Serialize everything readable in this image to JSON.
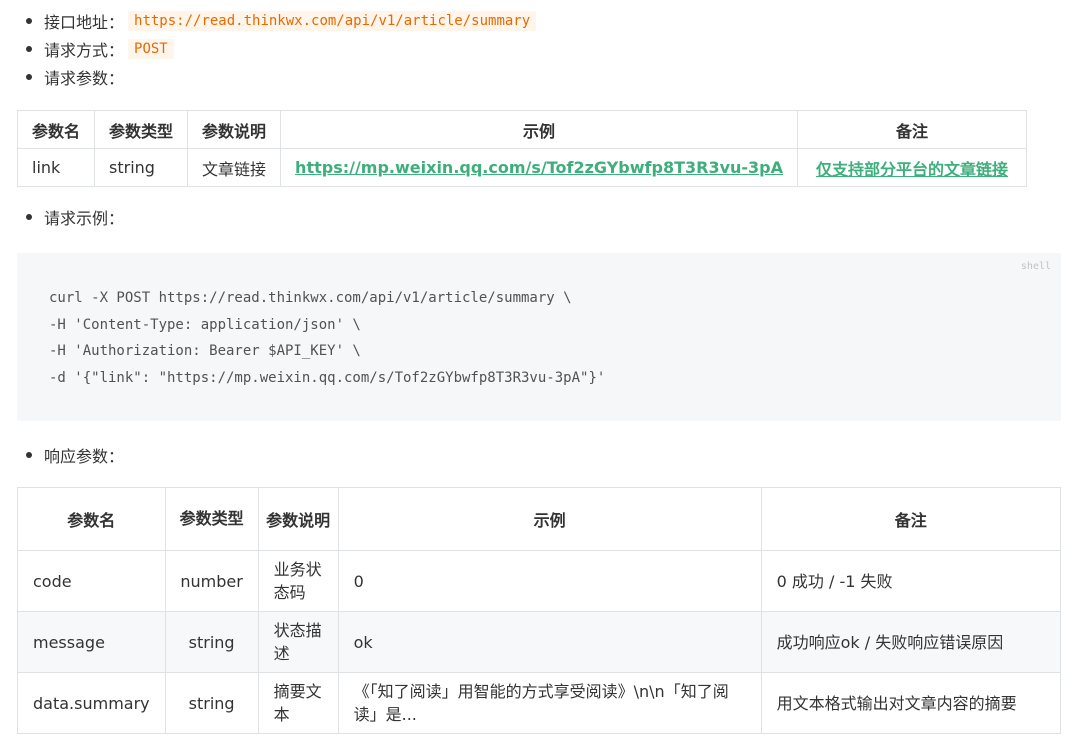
{
  "request": {
    "url_label": "接口地址：",
    "url_value": "https://read.thinkwx.com/api/v1/article/summary",
    "method_label": "请求方式：",
    "method_value": "POST",
    "params_label": "请求参数："
  },
  "request_table": {
    "headers": [
      "参数名",
      "参数类型",
      "参数说明",
      "示例",
      "备注"
    ],
    "row": {
      "name": "link",
      "type": "string",
      "desc": "文章链接",
      "example": "https://mp.weixin.qq.com/s/Tof2zGYbwfp8T3R3vu-3pA",
      "note": "仅支持部分平台的文章链接"
    }
  },
  "example": {
    "label": "请求示例：",
    "lang": "shell",
    "lines": [
      "curl -X POST https://read.thinkwx.com/api/v1/article/summary \\",
      "-H 'Content-Type: application/json' \\",
      "-H 'Authorization: Bearer $API_KEY' \\",
      "-d '{\"link\": \"https://mp.weixin.qq.com/s/Tof2zGYbwfp8T3R3vu-3pA\"}'"
    ]
  },
  "response": {
    "label": "响应参数：",
    "headers": [
      "参数名",
      "参数类型",
      "参数说明",
      "示例",
      "备注"
    ],
    "rows": [
      {
        "name": "code",
        "type": "number",
        "desc": "业务状态码",
        "example": "0",
        "note": "0 成功 / -1 失败"
      },
      {
        "name": "message",
        "type": "string",
        "desc": "状态描述",
        "example": "ok",
        "note": "成功响应ok / 失败响应错误原因"
      },
      {
        "name": "data.summary",
        "type": "string",
        "desc": "摘要文本",
        "example": "《「知了阅读」用智能的方式享受阅读》\\n\\n「知了阅读」是...",
        "note": "用文本格式输出对文章内容的摘要"
      }
    ]
  },
  "colors": {
    "inline_code": "#e96900",
    "link": "#3eaf7c",
    "border": "#dfe2e5",
    "code_bg": "#f6f7f8"
  }
}
